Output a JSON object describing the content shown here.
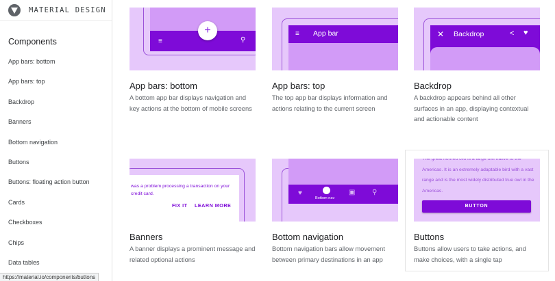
{
  "brand": {
    "title": "MATERIAL DESIGN"
  },
  "sidebar": {
    "section_title": "Components",
    "items": [
      "App bars: bottom",
      "App bars: top",
      "Backdrop",
      "Banners",
      "Bottom navigation",
      "Buttons",
      "Buttons: floating action button",
      "Cards",
      "Checkboxes",
      "Chips",
      "Data tables"
    ]
  },
  "status_bar": {
    "url": "https://material.io/components/buttons"
  },
  "colors": {
    "primary": "#7e0bd8",
    "thumb_bg": "#e6c8fb",
    "screen": "#d29bf7"
  },
  "cards": [
    {
      "title": "App bars: bottom",
      "description": "A bottom app bar displays navigation and key actions at the bottom of mobile screens",
      "thumb": {
        "fab_icon": "+",
        "menu_icon": "≡",
        "search_icon": "⚲"
      }
    },
    {
      "title": "App bars: top",
      "description": "The top app bar displays information and actions relating to the current screen",
      "thumb": {
        "menu_icon": "≡",
        "label": "App bar",
        "search_icon": "⚲"
      }
    },
    {
      "title": "Backdrop",
      "description": "A backdrop appears behind all other surfaces in an app, displaying contextual and actionable content",
      "thumb": {
        "close_icon": "✕",
        "label": "Backdrop",
        "share_icon": "<",
        "heart_icon": "♥"
      }
    },
    {
      "title": "Banners",
      "description": "A banner displays a prominent message and related optional actions",
      "thumb": {
        "text": "was a problem processing a transaction on your credit card.",
        "fix_label": "FIX IT",
        "learn_label": "LEARN MORE"
      }
    },
    {
      "title": "Bottom navigation",
      "description": "Bottom navigation bars allow movement between primary destinations in an app",
      "thumb": {
        "heart_icon": "♥",
        "label": "Bottom nav",
        "calendar_icon": "▣",
        "search_icon": "⚲"
      }
    },
    {
      "title": "Buttons",
      "description": "Buttons allow users to take actions, and make choices, with a single tap",
      "thumb": {
        "text": "The great horned owl is a large owl native to the Americas. It is an extremely adaptable bird with a vast range and is the most widely distributed true owl in the Americas.",
        "button_label": "BUTTON"
      }
    }
  ]
}
